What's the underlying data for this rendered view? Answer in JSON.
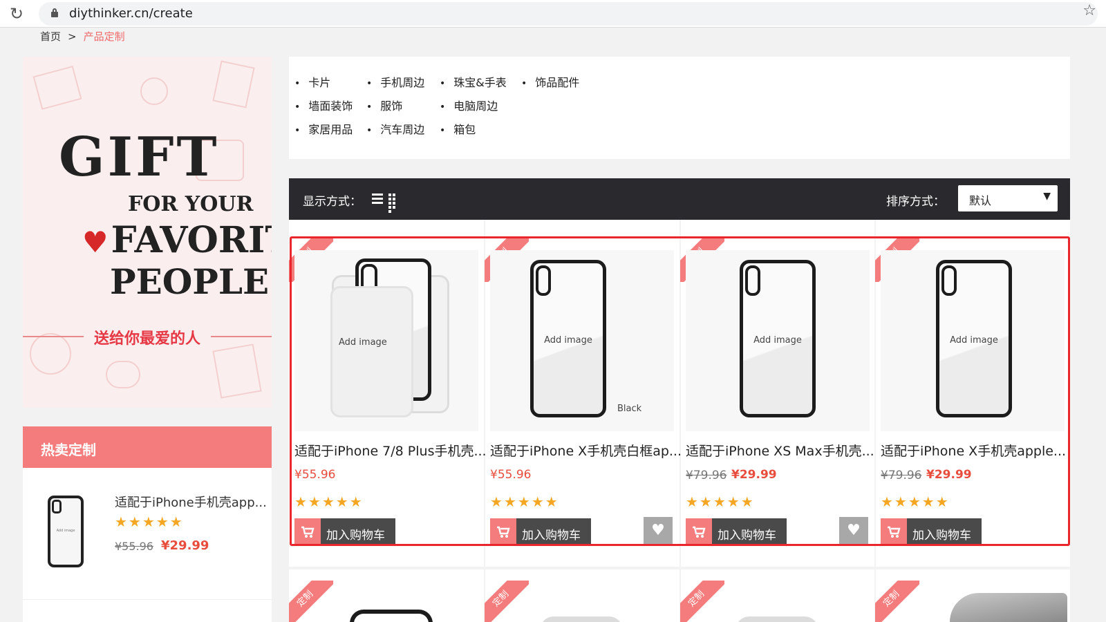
{
  "browser": {
    "url": "diythinker.cn/create"
  },
  "breadcrumb": {
    "home": "首页",
    "separator": ">",
    "current": "产品定制"
  },
  "banner": {
    "line1": "GIFT",
    "line2": "FOR YOUR",
    "line3": "FAVORITE",
    "line4": "PEOPLE",
    "caption": "送给你最爱的人",
    "heart": "♥"
  },
  "hot": {
    "title": "热卖定制",
    "item": {
      "name": "适配于iPhone手机壳app...",
      "stars": "★★★★★",
      "rating": 5,
      "old_price": "¥55.96",
      "price": "¥29.99",
      "thumb_text": "Add image"
    }
  },
  "categories": [
    "卡片",
    "手机周边",
    "珠宝&手表",
    "饰品配件",
    "墙面装饰",
    "服饰",
    "电脑周边",
    "家居用品",
    "汽车周边",
    "箱包"
  ],
  "toolbar": {
    "display_label": "显示方式：",
    "sort_label": "排序方式：",
    "sort_value": "默认"
  },
  "ribbon_text": "定制",
  "cart_label": "加入购物车",
  "products": [
    {
      "name": "适配于iPhone 7/8 Plus手机壳...",
      "price": "¥55.96",
      "old_price": "",
      "stars": "★★★★★",
      "rating": 5,
      "image_text": "Add image",
      "variant_label": ""
    },
    {
      "name": "适配于iPhone X手机壳白框ap...",
      "price": "¥55.96",
      "old_price": "",
      "stars": "★★★★★",
      "rating": 5,
      "image_text": "Add image",
      "variant_label": "Black"
    },
    {
      "name": "适配于iPhone XS Max手机壳...",
      "price": "¥29.99",
      "old_price": "¥79.96",
      "stars": "★★★★★",
      "rating": 5,
      "image_text": "Add image",
      "variant_label": ""
    },
    {
      "name": "适配于iPhone X手机壳apple...",
      "price": "¥29.99",
      "old_price": "¥79.96",
      "stars": "★★★★★",
      "rating": 5,
      "image_text": "Add image",
      "variant_label": ""
    }
  ],
  "colors": {
    "accent": "#f47c7c",
    "price": "#e74c3c",
    "toolbar": "#2a2a2e",
    "highlight": "#e8262b",
    "star": "#f5a623"
  },
  "icons": [
    "reload-icon",
    "lock-icon",
    "bookmark-star-icon",
    "list-view-icon",
    "grid-view-icon",
    "chevron-down-icon",
    "cart-icon",
    "heart-icon"
  ]
}
